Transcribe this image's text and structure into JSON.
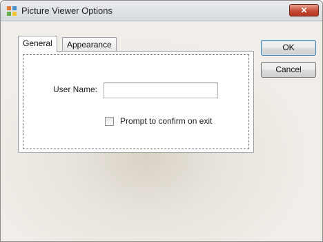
{
  "window": {
    "title": "Picture Viewer Options",
    "close_glyph": "✕"
  },
  "tabs": [
    {
      "label": "General",
      "active": true
    },
    {
      "label": "Appearance",
      "active": false
    }
  ],
  "general": {
    "user_name_label": "User Name:",
    "user_name_value": "",
    "prompt_label": "Prompt to confirm on exit",
    "prompt_checked": false
  },
  "buttons": {
    "ok": "OK",
    "cancel": "Cancel"
  },
  "icons": {
    "app": "picture-viewer-app-icon",
    "close": "close-icon",
    "checkbox": "checkbox-unchecked-icon"
  },
  "colors": {
    "close_button": "#c44b35",
    "titlebar": "#e0e3e6",
    "default_button_border": "#3c7fb1"
  }
}
